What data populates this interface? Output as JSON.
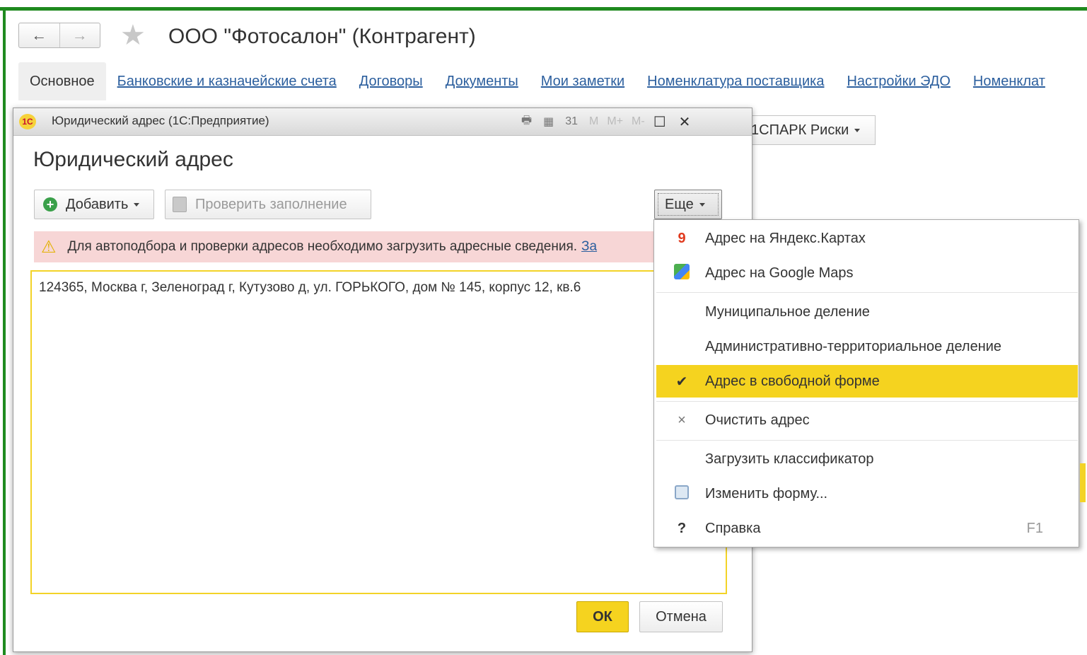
{
  "main_form": {
    "title": "ООО \"Фотосалон\" (Контрагент)",
    "nav": {
      "back_icon": "←",
      "forward_icon": "→",
      "favorite_icon": "★"
    },
    "tabs": [
      {
        "label": "Основное"
      },
      {
        "label": "Банковские и казначейские счета"
      },
      {
        "label": "Договоры"
      },
      {
        "label": "Документы"
      },
      {
        "label": "Мои заметки"
      },
      {
        "label": "Номенклатура поставщика"
      },
      {
        "label": "Настройки ЭДО"
      },
      {
        "label": "Номенклат"
      }
    ],
    "spark_button": {
      "label": "1СПАРК Риски"
    }
  },
  "dialog": {
    "window_title": "Юридический адрес  (1С:Предприятие)",
    "app_icon": "1С",
    "titlebar_icons": {
      "print": "🖶",
      "calc": "▦",
      "calendar": "31",
      "m": "M",
      "m_plus": "M+",
      "m_minus": "M-",
      "maximize": "☐",
      "close": "✕"
    },
    "heading": "Юридический адрес",
    "toolbar": {
      "add_label": "Добавить",
      "check_label": "Проверить заполнение",
      "more_label": "Еще"
    },
    "warning": {
      "text": "Для автоподбора и проверки адресов необходимо загрузить адресные сведения.",
      "link": "За"
    },
    "address_value": "124365, Москва г, Зеленоград г, Кутузово д, ул. ГОРЬКОГО, дом № 145, корпус 12, кв.6",
    "ok_label": "ОК",
    "cancel_label": "Отмена"
  },
  "menu": {
    "items": [
      {
        "label": "Адрес на Яндекс.Картах",
        "icon": "map-pin-icon"
      },
      {
        "label": "Адрес на Google Maps",
        "icon": "google-maps-icon"
      },
      {
        "label": "Муниципальное деление"
      },
      {
        "label": "Административно-территориальное деление"
      },
      {
        "label": "Адрес в свободной форме",
        "icon": "checkmark-icon",
        "checked": true
      },
      {
        "label": "Очистить адрес",
        "icon": "clear-icon"
      },
      {
        "label": "Загрузить классификатор"
      },
      {
        "label": "Изменить форму...",
        "icon": "form-settings-icon"
      },
      {
        "label": "Справка",
        "icon": "help-icon",
        "shortcut": "F1"
      }
    ],
    "check_glyph": "✔",
    "clear_glyph": "×",
    "help_glyph": "?",
    "pin_glyph": "9"
  },
  "colors": {
    "accent_yellow": "#f5d31f",
    "link_blue": "#2c5f9e",
    "warning_bg": "#f7d6d6",
    "frame_green": "#1f8a1f"
  }
}
